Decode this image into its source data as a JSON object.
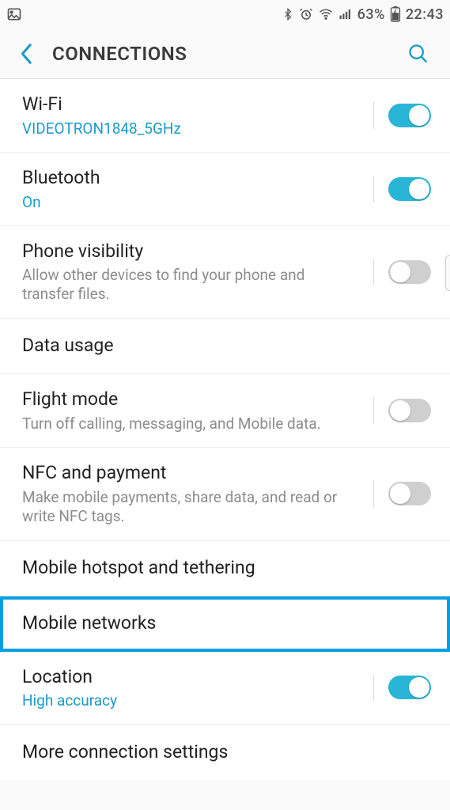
{
  "statusbar": {
    "battery_pct": "63%",
    "time": "22:43"
  },
  "header": {
    "title": "CONNECTIONS"
  },
  "rows": {
    "wifi": {
      "title": "Wi-Fi",
      "sub": "VIDEOTRON1848_5GHz",
      "on": true
    },
    "bt": {
      "title": "Bluetooth",
      "sub": "On",
      "on": true
    },
    "vis": {
      "title": "Phone visibility",
      "sub": "Allow other devices to find your phone and transfer files.",
      "on": false
    },
    "data": {
      "title": "Data usage"
    },
    "flight": {
      "title": "Flight mode",
      "sub": "Turn off calling, messaging, and Mobile data.",
      "on": false
    },
    "nfc": {
      "title": "NFC and payment",
      "sub": "Make mobile payments, share data, and read or write NFC tags.",
      "on": false
    },
    "hotspot": {
      "title": "Mobile hotspot and tethering"
    },
    "mobnet": {
      "title": "Mobile networks"
    },
    "loc": {
      "title": "Location",
      "sub": "High accuracy",
      "on": true
    },
    "more": {
      "title": "More connection settings"
    }
  }
}
